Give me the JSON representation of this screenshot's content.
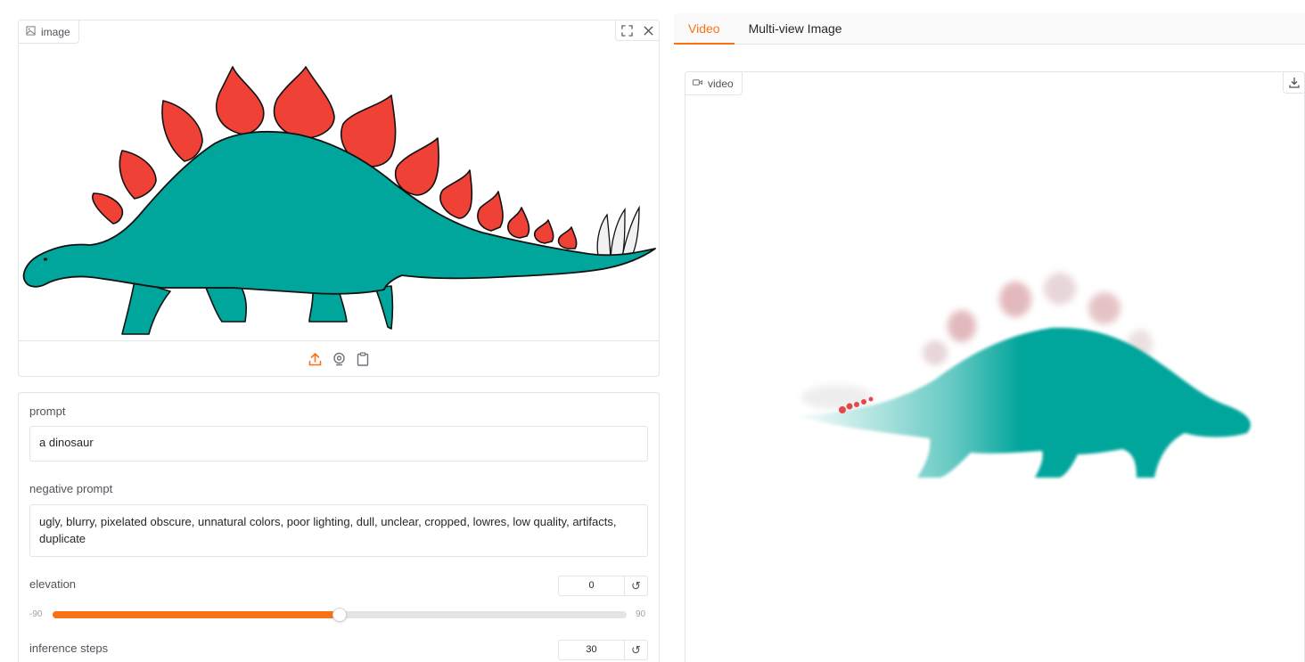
{
  "image_input": {
    "label": "image"
  },
  "form": {
    "prompt_label": "prompt",
    "prompt_value": "a dinosaur",
    "negative_label": "negative prompt",
    "negative_value": "ugly, blurry, pixelated obscure, unnatural colors, poor lighting, dull, unclear, cropped, lowres, low quality, artifacts, duplicate",
    "elevation": {
      "label": "elevation",
      "value": "0",
      "min": "-90",
      "max": "90",
      "fraction": 0.5
    },
    "steps": {
      "label": "inference steps",
      "value": "30"
    }
  },
  "tabs": [
    "Video",
    "Multi-view Image"
  ],
  "output": {
    "label": "video"
  },
  "colors": {
    "accent": "#f97316",
    "dino_body": "#00a59b",
    "dino_plates": "#ef4136"
  },
  "icons": [
    "image-icon",
    "fullscreen-icon",
    "close-icon",
    "upload-icon",
    "webcam-icon",
    "clipboard-icon",
    "reset-icon",
    "video-icon",
    "download-icon"
  ]
}
